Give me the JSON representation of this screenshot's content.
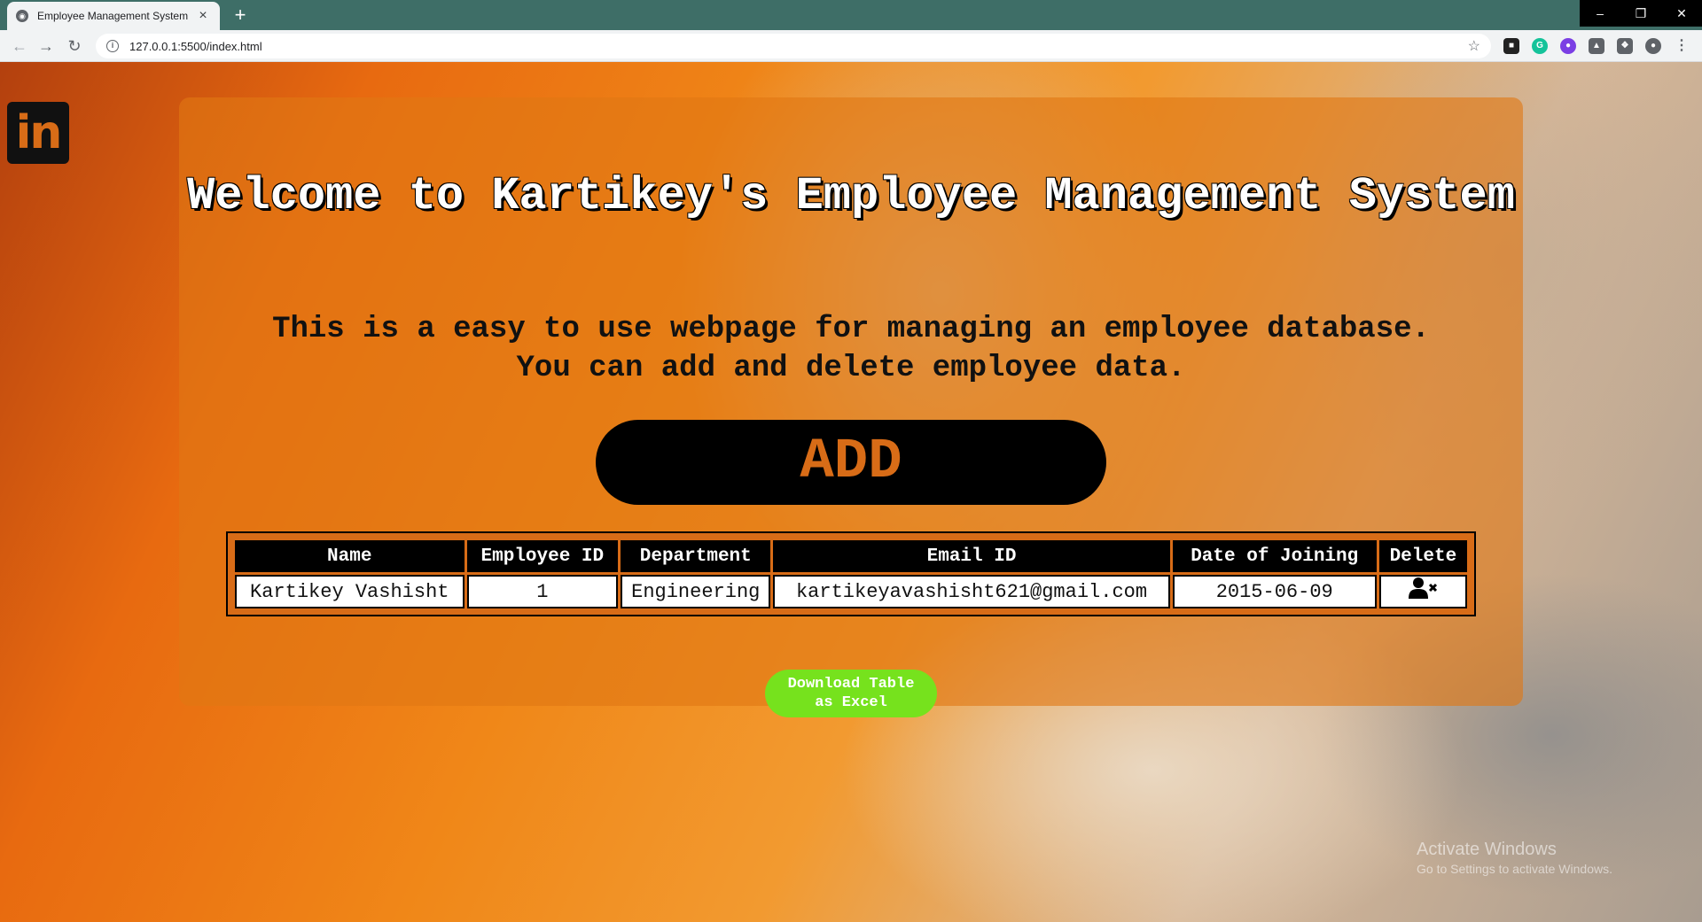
{
  "browser": {
    "tab_title": "Employee Management System",
    "url": "127.0.0.1:5500/index.html"
  },
  "page": {
    "title": "Welcome to Kartikey's Employee Management System",
    "subtitle_line1": "This is a easy to use webpage for managing an employee database.",
    "subtitle_line2": "You can add and delete employee data.",
    "add_label": "ADD",
    "download_line1": "Download Table",
    "download_line2": "as Excel",
    "social_icon": "linkedin-icon",
    "linkedin_text": "in"
  },
  "table": {
    "headers": [
      "Name",
      "Employee ID",
      "Department",
      "Email ID",
      "Date of Joining",
      "Delete"
    ],
    "rows": [
      {
        "name": "Kartikey Vashisht",
        "employee_id": "1",
        "department": "Engineering",
        "email": "kartikeyavashisht621@gmail.com",
        "doj": "2015-06-09",
        "delete_icon": "user-delete-icon"
      }
    ]
  },
  "os": {
    "watermark_line1": "Activate Windows",
    "watermark_line2": "Go to Settings to activate Windows."
  },
  "colors": {
    "accent": "#d86c17",
    "download_green": "#76e21d"
  }
}
